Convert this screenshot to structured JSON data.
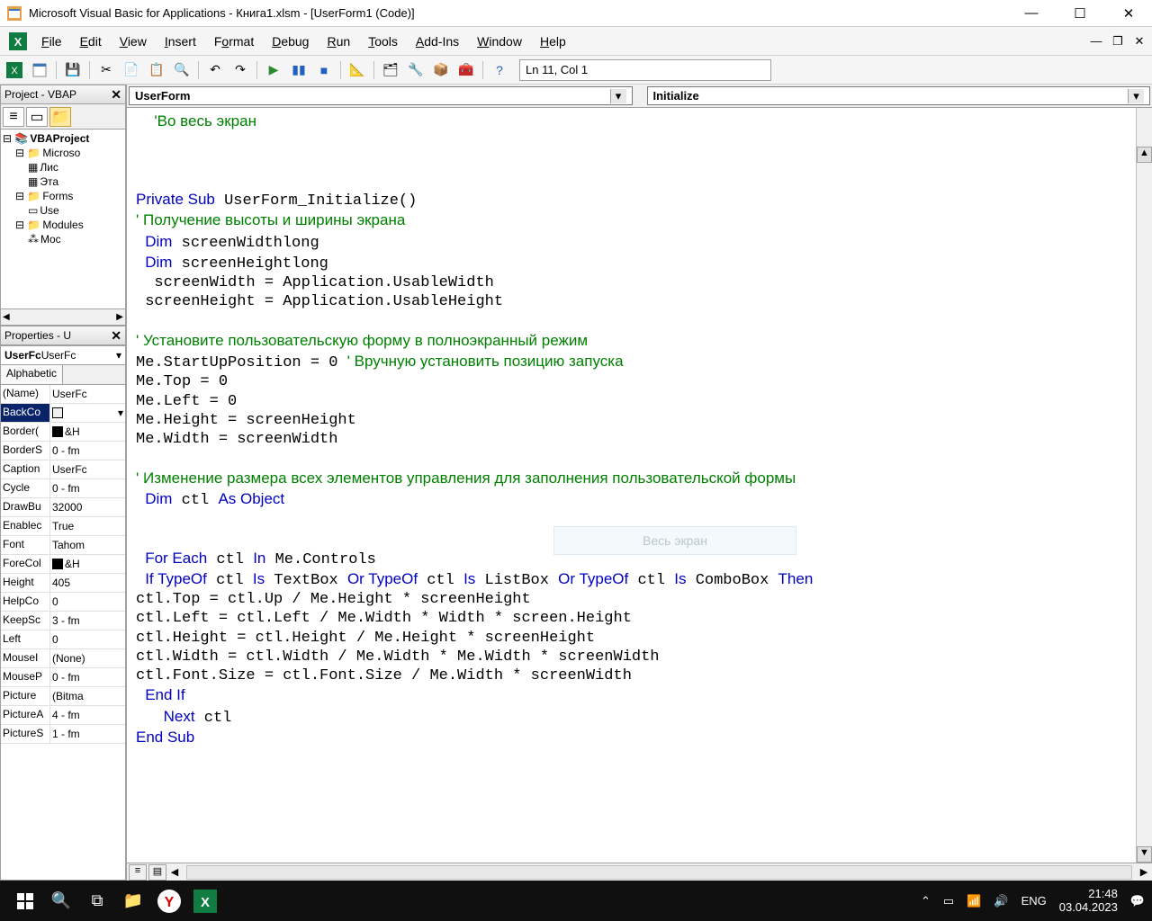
{
  "titlebar": {
    "title": "Microsoft Visual Basic for Applications - Книга1.xlsm - [UserForm1 (Code)]"
  },
  "menu": {
    "file": "File",
    "edit": "Edit",
    "view": "View",
    "insert": "Insert",
    "format": "Format",
    "debug": "Debug",
    "run": "Run",
    "tools": "Tools",
    "addins": "Add-Ins",
    "window": "Window",
    "help": "Help"
  },
  "toolbar_status": "Ln 11, Col 1",
  "project_pane": {
    "title": "Project - VBAP",
    "root": "VBAProject",
    "nodes": {
      "microsoft": "Microso",
      "sheet1": "Лис",
      "thisworkbook": "Эта",
      "forms": "Forms",
      "userform": "Use",
      "modules": "Modules",
      "module1": "Moc"
    }
  },
  "properties_pane": {
    "title": "Properties - U",
    "combo_bold": "UserFc",
    "combo_rest": " UserFc",
    "tab_alpha": "Alphabetic",
    "rows": [
      {
        "name": "(Name)",
        "val": "UserFc"
      },
      {
        "name": "BackCo",
        "val": "",
        "swatch": "#f0f0f0",
        "dd": true,
        "sel": true
      },
      {
        "name": "Border(",
        "val": "&H",
        "swatch": "#000000"
      },
      {
        "name": "BorderS",
        "val": "0 - fm"
      },
      {
        "name": "Caption",
        "val": "UserFc"
      },
      {
        "name": "Cycle",
        "val": "0 - fm"
      },
      {
        "name": "DrawBu",
        "val": "32000"
      },
      {
        "name": "Enablec",
        "val": "True"
      },
      {
        "name": "Font",
        "val": "Tahom"
      },
      {
        "name": "ForeCol",
        "val": "&H",
        "swatch": "#000000"
      },
      {
        "name": "Height",
        "val": "405"
      },
      {
        "name": "HelpCo",
        "val": "0"
      },
      {
        "name": "KeepSc",
        "val": "3 - fm"
      },
      {
        "name": "Left",
        "val": "0"
      },
      {
        "name": "MouseI",
        "val": "(None)"
      },
      {
        "name": "MouseP",
        "val": "0 - fm"
      },
      {
        "name": "Picture",
        "val": "(Bitma"
      },
      {
        "name": "PictureA",
        "val": "4 - fm"
      },
      {
        "name": "PictureS",
        "val": "1 - fm"
      }
    ]
  },
  "code": {
    "dd_left": "UserForm",
    "dd_right": "Initialize",
    "ghost_button": "Весь экран"
  },
  "taskbar": {
    "lang": "ENG",
    "time": "21:48",
    "date": "03.04.2023"
  }
}
